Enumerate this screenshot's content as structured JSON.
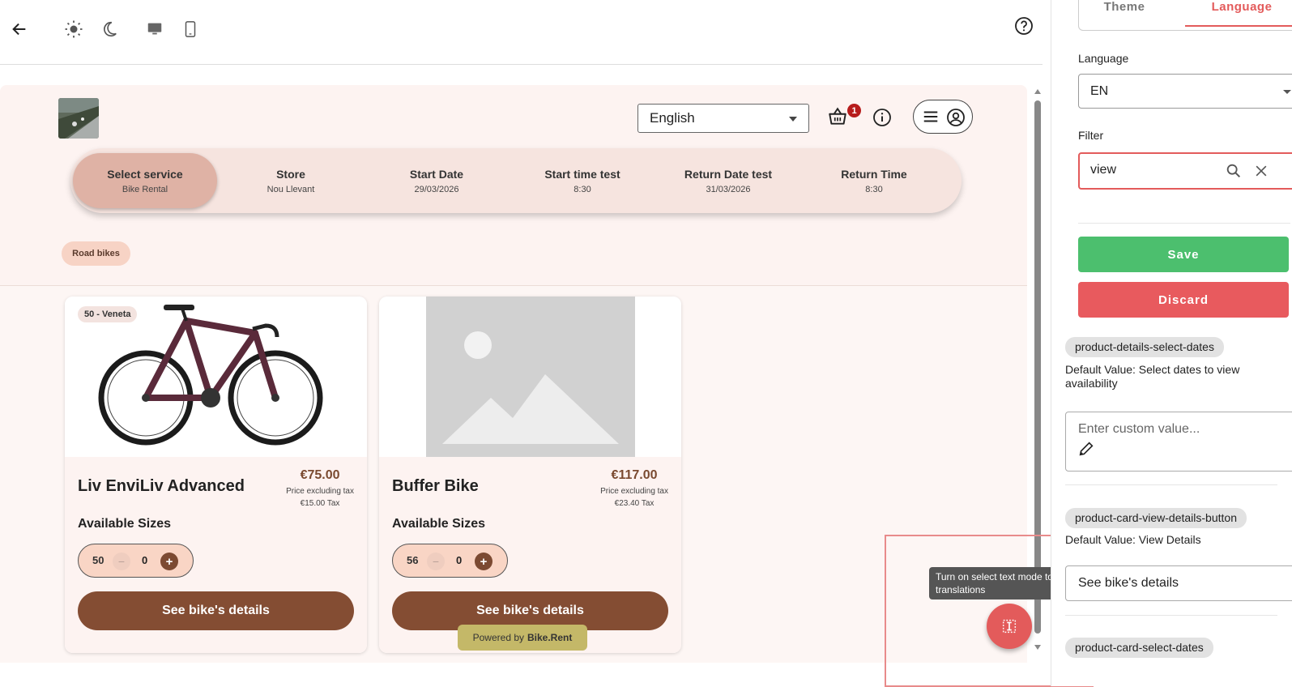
{
  "toolbar": {
    "back_icon": "arrow-left-icon",
    "light_icon": "sun-icon",
    "dark_icon": "moon-icon",
    "desktop_icon": "monitor-icon",
    "mobile_icon": "phone-icon",
    "help_icon": "help-circle-icon"
  },
  "preview": {
    "language_select": "English",
    "cart_count": "1",
    "steps": [
      {
        "title": "Select service",
        "value": "Bike Rental"
      },
      {
        "title": "Store",
        "value": "Nou Llevant"
      },
      {
        "title": "Start Date",
        "value": "29/03/2026"
      },
      {
        "title": "Start time test",
        "value": "8:30"
      },
      {
        "title": "Return Date test",
        "value": "31/03/2026"
      },
      {
        "title": "Return Time",
        "value": "8:30"
      }
    ],
    "category_chip": "Road bikes",
    "products": [
      {
        "badge": "50 - Veneta",
        "name": "Liv EnviLiv Advanced",
        "price": "€75.00",
        "price_note": "Price excluding tax",
        "tax": "€15.00 Tax",
        "sizes_label": "Available Sizes",
        "size": "50",
        "minus": "−",
        "qty": "0",
        "plus": "+",
        "button": "See bike's details"
      },
      {
        "badge": "",
        "name": "Buffer Bike",
        "price": "€117.00",
        "price_note": "Price excluding tax",
        "tax": "€23.40 Tax",
        "sizes_label": "Available Sizes",
        "size": "56",
        "minus": "−",
        "qty": "0",
        "plus": "+",
        "button": "See bike's details"
      }
    ],
    "powered_prefix": "Powered by",
    "powered_brand": "Bike.Rent",
    "tooltip": "Turn on select text mode to edit translations"
  },
  "panel": {
    "tabs": [
      {
        "label": "Theme",
        "active": false
      },
      {
        "label": "Language",
        "active": true
      }
    ],
    "language_label": "Language",
    "language_value": "EN",
    "filter_label": "Filter",
    "filter_value": "view",
    "save_label": "Save",
    "discard_label": "Discard",
    "entries": [
      {
        "key": "product-details-select-dates",
        "default_value": "Default Value: Select dates to view availability",
        "input_value": "",
        "input_placeholder": "Enter custom value..."
      },
      {
        "key": "product-card-view-details-button",
        "default_value": "Default Value: View Details",
        "input_value": "See bike's details",
        "input_placeholder": ""
      },
      {
        "key": "product-card-select-dates",
        "default_value": "",
        "input_value": "",
        "input_placeholder": ""
      }
    ]
  },
  "colors": {
    "accent_red": "#e35b5b",
    "brand_brown": "#844d33",
    "save_green": "#4cbf6e",
    "discard_red": "#e85a5e"
  }
}
